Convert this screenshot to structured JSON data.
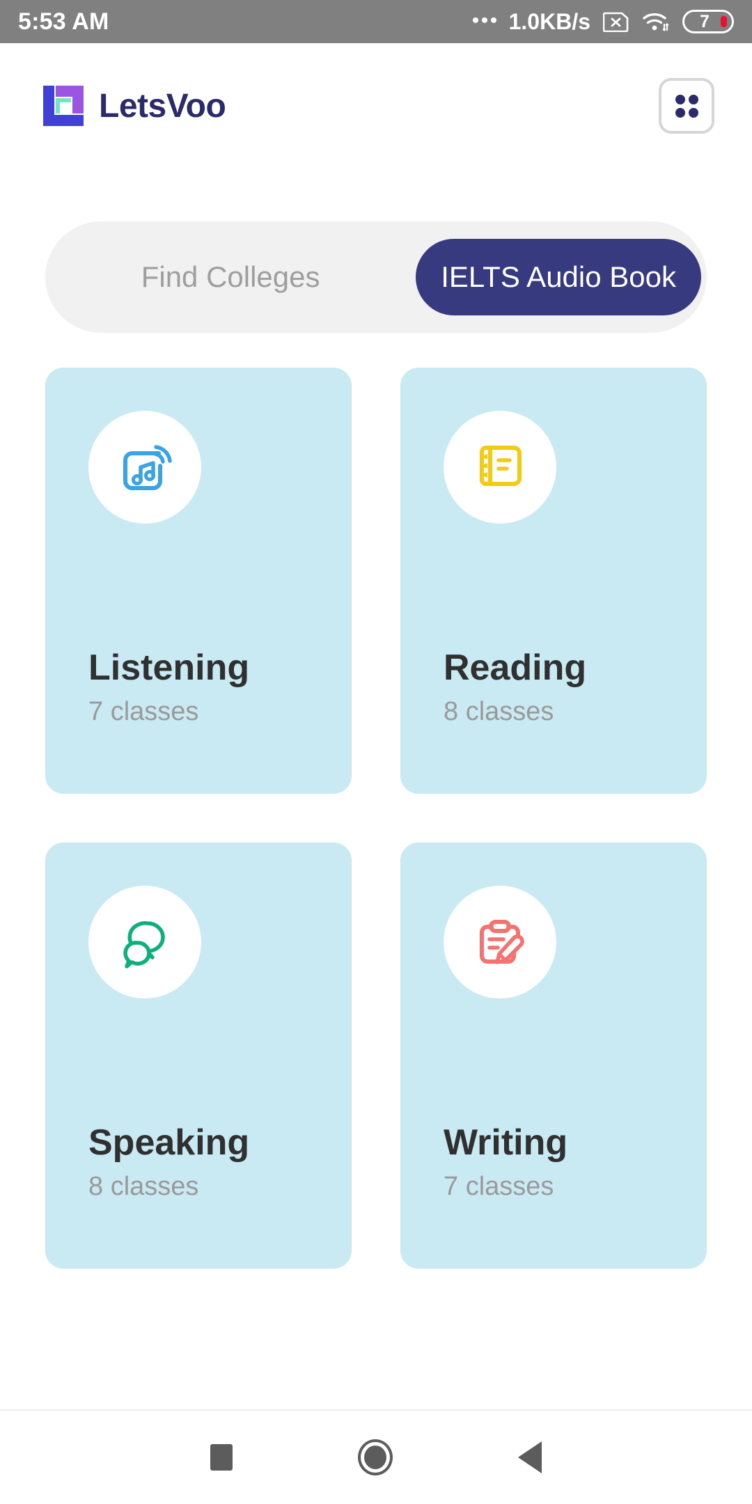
{
  "status_bar": {
    "clock": "5:53 AM",
    "network_speed": "1.0KB/s",
    "leading_dots_icon": "ellipsis-icon",
    "sim_icon": "sim-card-disabled-icon",
    "wifi_icon": "wifi-icon",
    "battery_icon": "battery-icon",
    "battery_level": "7",
    "battery_accent": "#e8112d",
    "bar_background": "#808080"
  },
  "header": {
    "brand_name": "LetsVoo",
    "logo_icon": "letsvoo-logo-icon",
    "logo_colors": {
      "blue": "#4040d8",
      "purple": "#9b55e0",
      "teal": "#6fe3cf"
    },
    "brand_text_color": "#2b2a6b",
    "menu_icon": "grid-menu-icon"
  },
  "tabs": {
    "items": [
      {
        "label": "Find Colleges",
        "active": false
      },
      {
        "label": "IELTS Audio Book",
        "active": true
      }
    ],
    "active_background": "#373a7f",
    "track_background": "#f1f1f1",
    "inactive_color": "#9e9e9e"
  },
  "cards": [
    {
      "title": "Listening",
      "subtitle": "7 classes",
      "icon": "music-audio-icon",
      "icon_color": "#3aa3e3",
      "card_background": "#c9e9f3"
    },
    {
      "title": "Reading",
      "subtitle": "8 classes",
      "icon": "notebook-icon",
      "icon_color": "#f2cb12",
      "card_background": "#c9e9f3"
    },
    {
      "title": "Speaking",
      "subtitle": "8 classes",
      "icon": "chat-bubbles-icon",
      "icon_color": "#0db07b",
      "card_background": "#c9e9f3"
    },
    {
      "title": "Writing",
      "subtitle": "7 classes",
      "icon": "clipboard-pencil-icon",
      "icon_color": "#f4726f",
      "card_background": "#c9e9f3"
    }
  ],
  "navigation_bar": {
    "recents_icon": "square-recents-icon",
    "home_icon": "circle-home-icon",
    "back_icon": "triangle-back-icon",
    "icon_color": "#5c5c5c"
  }
}
